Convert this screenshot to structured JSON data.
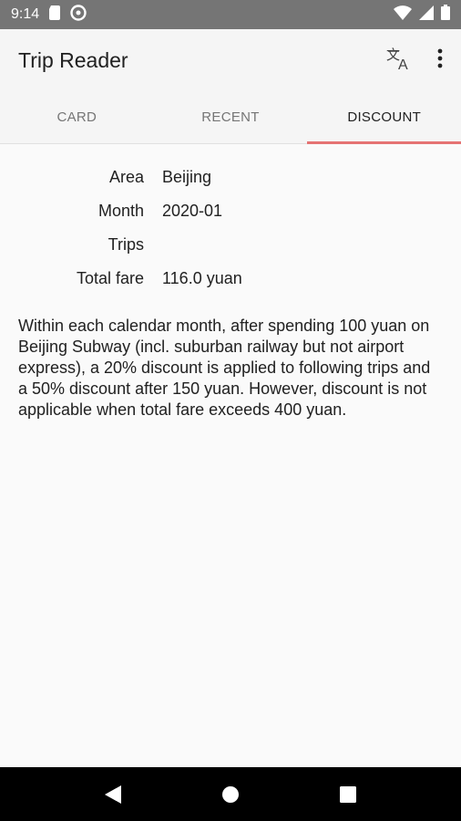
{
  "status_bar": {
    "time": "9:14",
    "icons": [
      "sd-card-icon",
      "do-not-disturb-icon",
      "wifi-icon",
      "signal-icon",
      "battery-icon"
    ]
  },
  "app_bar": {
    "title": "Trip Reader",
    "actions": [
      "translate-icon",
      "more-vert-icon"
    ]
  },
  "tabs": [
    {
      "label": "CARD",
      "active": false
    },
    {
      "label": "RECENT",
      "active": false
    },
    {
      "label": "DISCOUNT",
      "active": true
    }
  ],
  "info": [
    {
      "key": "Area",
      "value": "Beijing"
    },
    {
      "key": "Month",
      "value": "2020-01"
    },
    {
      "key": "Trips",
      "value": ""
    },
    {
      "key": "Total fare",
      "value": "116.0 yuan"
    }
  ],
  "description": "Within each calendar month, after spending 100 yuan on Beijing Subway (incl. suburban railway but not airport express), a 20% discount is applied to following trips and a 50% discount after 150 yuan. However, discount is not applicable when total fare exceeds 400 yuan.",
  "colors": {
    "status_bar": "#757575",
    "tab_indicator": "#e57373",
    "nav_bar": "#000000"
  },
  "nav": [
    "back-icon",
    "home-icon",
    "recents-icon"
  ]
}
